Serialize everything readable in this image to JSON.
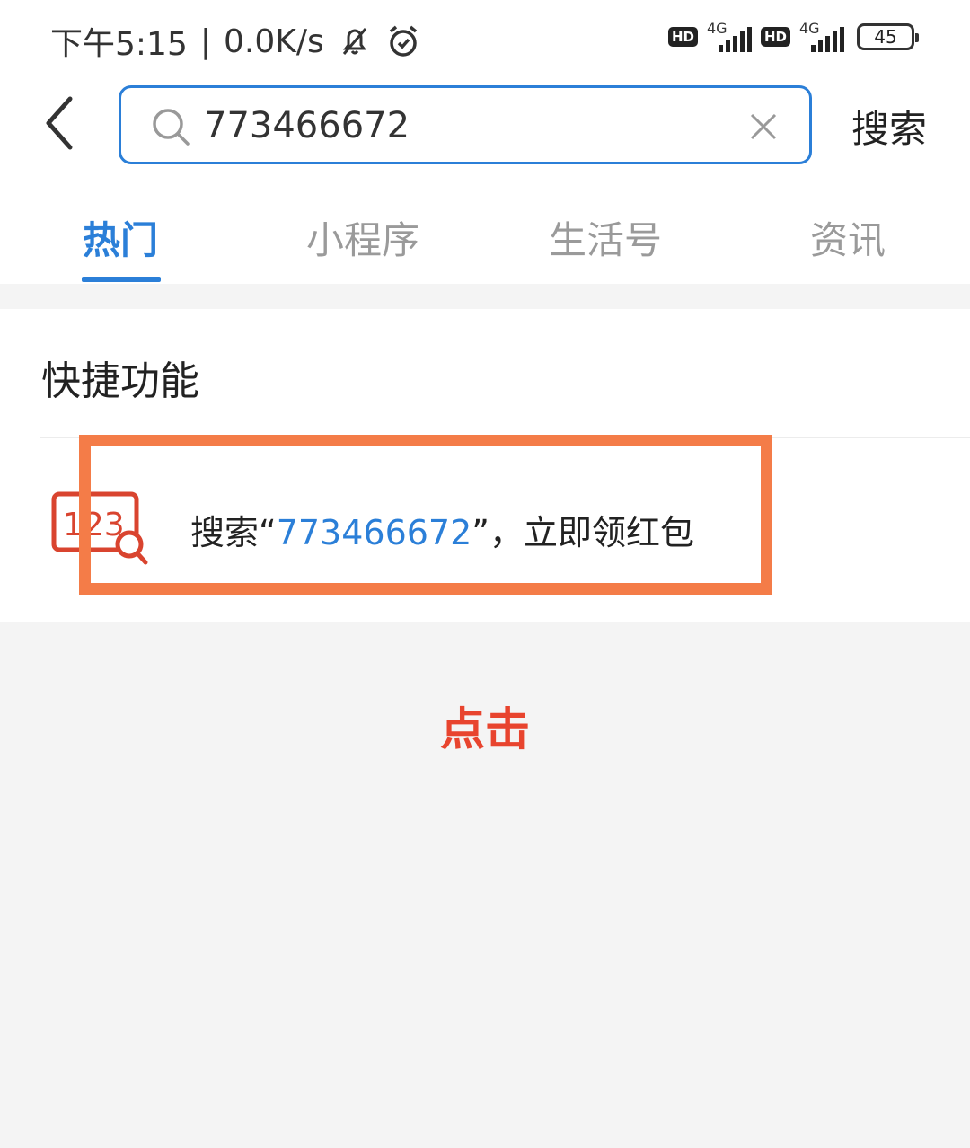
{
  "status_bar": {
    "time": "下午5:15",
    "separator": "|",
    "speed": "0.0K/s",
    "hd_label": "HD",
    "network_label": "4G",
    "battery": "45"
  },
  "search": {
    "value": "773466672",
    "button_label": "搜索"
  },
  "tabs": [
    {
      "label": "热门",
      "active": true
    },
    {
      "label": "小程序",
      "active": false
    },
    {
      "label": "生活号",
      "active": false
    },
    {
      "label": "资讯",
      "active": false
    }
  ],
  "quick_section": {
    "title": "快捷功能",
    "icon_text": "123",
    "item": {
      "prefix": "搜索“",
      "query": "773466672",
      "suffix": "”，立即领红包"
    }
  },
  "annotation": {
    "hint": "点击",
    "frame_color": "#f47c48",
    "hint_color": "#e8442e"
  },
  "colors": {
    "accent": "#2b7fd8",
    "icon_red": "#d9442f"
  }
}
